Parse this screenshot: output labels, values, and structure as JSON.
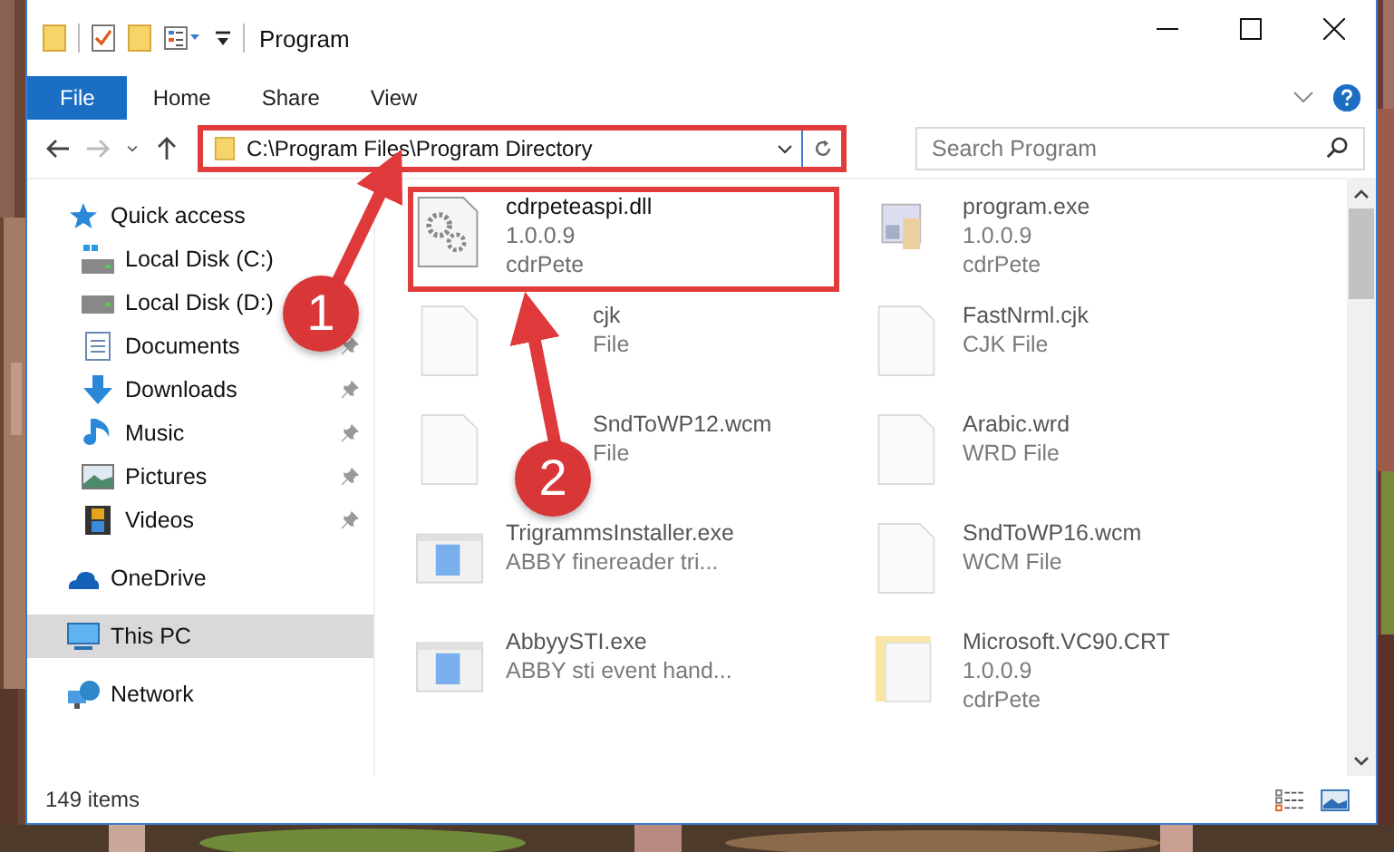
{
  "window": {
    "title": "Program"
  },
  "ribbon_tabs": [
    {
      "label": "File",
      "selected": true
    },
    {
      "label": "Home",
      "selected": false
    },
    {
      "label": "Share",
      "selected": false
    },
    {
      "label": "View",
      "selected": false
    }
  ],
  "address": {
    "value": "C:\\Program Files\\Program Directory",
    "highlighted": true
  },
  "search": {
    "placeholder": "Search Program"
  },
  "sidebar": {
    "items": [
      {
        "label": "Quick access",
        "kind": "star",
        "selected": false,
        "children": [
          {
            "label": "Local Disk (C:)",
            "kind": "disk-c",
            "pinned": false,
            "selected": false
          },
          {
            "label": "Local Disk (D:)",
            "kind": "disk",
            "pinned": false,
            "selected": false
          },
          {
            "label": "Documents",
            "kind": "documents",
            "pinned": true,
            "selected": false
          },
          {
            "label": "Downloads",
            "kind": "downloads",
            "pinned": true,
            "selected": false
          },
          {
            "label": "Music",
            "kind": "music",
            "pinned": true,
            "selected": false
          },
          {
            "label": "Pictures",
            "kind": "pictures",
            "pinned": true,
            "selected": false
          },
          {
            "label": "Videos",
            "kind": "videos",
            "pinned": true,
            "selected": false
          }
        ]
      },
      {
        "label": "OneDrive",
        "kind": "cloud",
        "selected": false
      },
      {
        "label": "This PC",
        "kind": "pc",
        "selected": true
      },
      {
        "label": "Network",
        "kind": "network",
        "selected": false
      }
    ]
  },
  "files": [
    {
      "kind": "dll",
      "lines": [
        "cdrpeteaspi.dll",
        "1.0.0.9",
        "cdrPete"
      ],
      "highlighted": true,
      "blurred": false,
      "covered": false
    },
    {
      "kind": "exe",
      "lines": [
        "program.exe",
        "1.0.0.9",
        "cdrPete"
      ],
      "highlighted": false,
      "blurred": true,
      "covered": false
    },
    {
      "kind": "doc",
      "lines": [
        "cjk",
        "File"
      ],
      "highlighted": false,
      "blurred": true,
      "covered": true
    },
    {
      "kind": "doc",
      "lines": [
        "FastNrml.cjk",
        "CJK File"
      ],
      "highlighted": false,
      "blurred": true,
      "covered": false
    },
    {
      "kind": "doc",
      "lines": [
        "SndToWP12.wcm",
        "File"
      ],
      "highlighted": false,
      "blurred": true,
      "covered": true
    },
    {
      "kind": "doc",
      "lines": [
        "Arabic.wrd",
        "WRD File"
      ],
      "highlighted": false,
      "blurred": true,
      "covered": false
    },
    {
      "kind": "app",
      "lines": [
        "TrigrammsInstaller.exe",
        "ABBY finereader tri..."
      ],
      "highlighted": false,
      "blurred": true,
      "covered": false
    },
    {
      "kind": "doc",
      "lines": [
        "SndToWP16.wcm",
        "WCM File"
      ],
      "highlighted": false,
      "blurred": true,
      "covered": false
    },
    {
      "kind": "app",
      "lines": [
        "AbbyySTI.exe",
        "ABBY sti event hand..."
      ],
      "highlighted": false,
      "blurred": true,
      "covered": false
    },
    {
      "kind": "package",
      "lines": [
        "Microsoft.VC90.CRT",
        "1.0.0.9",
        "cdrPete"
      ],
      "highlighted": false,
      "blurred": true,
      "covered": false
    }
  ],
  "status_bar": {
    "item_count": "149 items"
  },
  "callouts": [
    {
      "number": "1"
    },
    {
      "number": "2"
    }
  ]
}
